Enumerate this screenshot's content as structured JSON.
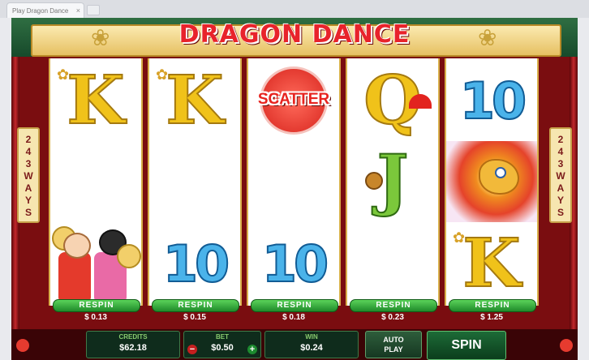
{
  "browser": {
    "tab_title": "Play Dragon Dance",
    "tab_close": "×"
  },
  "game": {
    "title": "DRAGON DANCE",
    "ways": [
      "2",
      "4",
      "3",
      "W",
      "A",
      "Y",
      "S"
    ],
    "ways_label": "243 WAYS"
  },
  "reels": [
    {
      "symbols": [
        "K",
        "",
        "kids"
      ],
      "respin_label": "RESPIN",
      "respin_cost": "$ 0.13"
    },
    {
      "symbols": [
        "K",
        "",
        "10"
      ],
      "respin_label": "RESPIN",
      "respin_cost": "$ 0.15"
    },
    {
      "symbols": [
        "SCATTER",
        "",
        "10"
      ],
      "respin_label": "RESPIN",
      "respin_cost": "$ 0.18"
    },
    {
      "symbols": [
        "Q",
        "J",
        ""
      ],
      "respin_label": "RESPIN",
      "respin_cost": "$ 0.23"
    },
    {
      "symbols": [
        "10",
        "dragon",
        "K"
      ],
      "respin_label": "RESPIN",
      "respin_cost": "$ 1.25"
    }
  ],
  "bottom_bar": {
    "credits_label": "CREDITS",
    "credits_value": "$62.18",
    "bet_label": "BET",
    "bet_value": "$0.50",
    "bet_minus": "−",
    "bet_plus": "+",
    "win_label": "WIN",
    "win_value": "$0.24",
    "auto_play_line1": "AUTO",
    "auto_play_line2": "PLAY",
    "spin_label": "SPIN"
  },
  "colors": {
    "title_red": "#e8232b",
    "respin_green": "#1f8a2a",
    "frame_red": "#7a0d10"
  }
}
